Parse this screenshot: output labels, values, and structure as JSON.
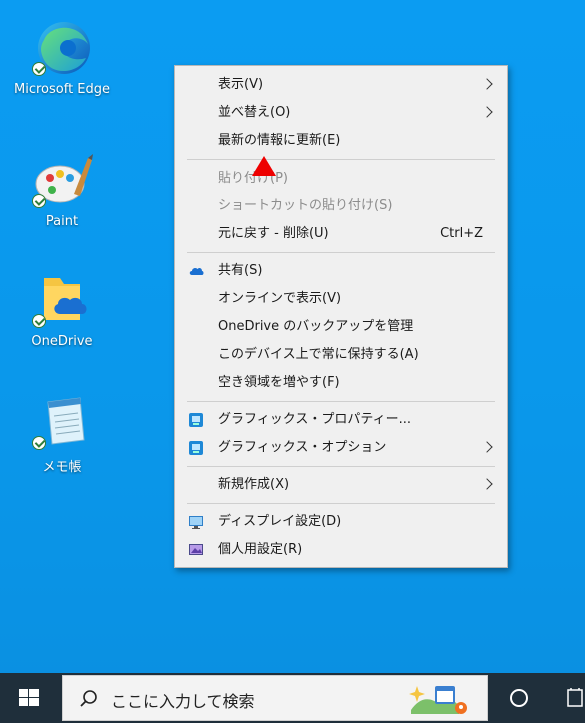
{
  "desktop": {
    "icons": [
      {
        "label": "Microsoft Edge"
      },
      {
        "label": "Paint"
      },
      {
        "label": "OneDrive"
      },
      {
        "label": "メモ帳"
      }
    ]
  },
  "context_menu": {
    "view": "表示(V)",
    "sort": "並べ替え(O)",
    "refresh": "最新の情報に更新(E)",
    "paste": "貼り付け(P)",
    "paste_shortcut": "ショートカットの貼り付け(S)",
    "undo": "元に戻す - 削除(U)",
    "undo_shortcut": "Ctrl+Z",
    "share": "共有(S)",
    "view_online": "オンラインで表示(V)",
    "manage_backup": "OneDrive のバックアップを管理",
    "always_keep": "このデバイス上で常に保持する(A)",
    "free_space": "空き領域を増やす(F)",
    "graphics_properties": "グラフィックス・プロパティー...",
    "graphics_options": "グラフィックス・オプション",
    "new": "新規作成(X)",
    "display_settings": "ディスプレイ設定(D)",
    "personalize": "個人用設定(R)"
  },
  "taskbar": {
    "search_placeholder": "ここに入力して検索"
  },
  "colors": {
    "desktop": "#0b9cf2",
    "taskbar": "#1f2f3b",
    "marker": "#ee0000"
  }
}
